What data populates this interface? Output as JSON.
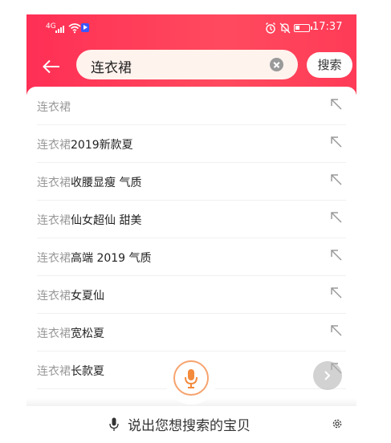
{
  "status_bar": {
    "signal_label": "4G",
    "time": "17:37"
  },
  "search": {
    "query": "连衣裙",
    "button_label": "搜索"
  },
  "suggestions": [
    {
      "prefix": "连衣裙",
      "suffix": ""
    },
    {
      "prefix": "连衣裙",
      "suffix": "2019新款夏"
    },
    {
      "prefix": "连衣裙",
      "suffix": "收腰显瘦 气质"
    },
    {
      "prefix": "连衣裙",
      "suffix": "仙女超仙 甜美"
    },
    {
      "prefix": "连衣裙",
      "suffix": "高端 2019 气质"
    },
    {
      "prefix": "连衣裙",
      "suffix": "女夏仙"
    },
    {
      "prefix": "连衣裙",
      "suffix": "宽松夏"
    },
    {
      "prefix": "连衣裙",
      "suffix": "长款夏"
    }
  ],
  "voice": {
    "hint": "说出您想搜索的宝贝"
  },
  "colors": {
    "header": "#ff3b57",
    "voice_accent": "#f38a3c"
  }
}
